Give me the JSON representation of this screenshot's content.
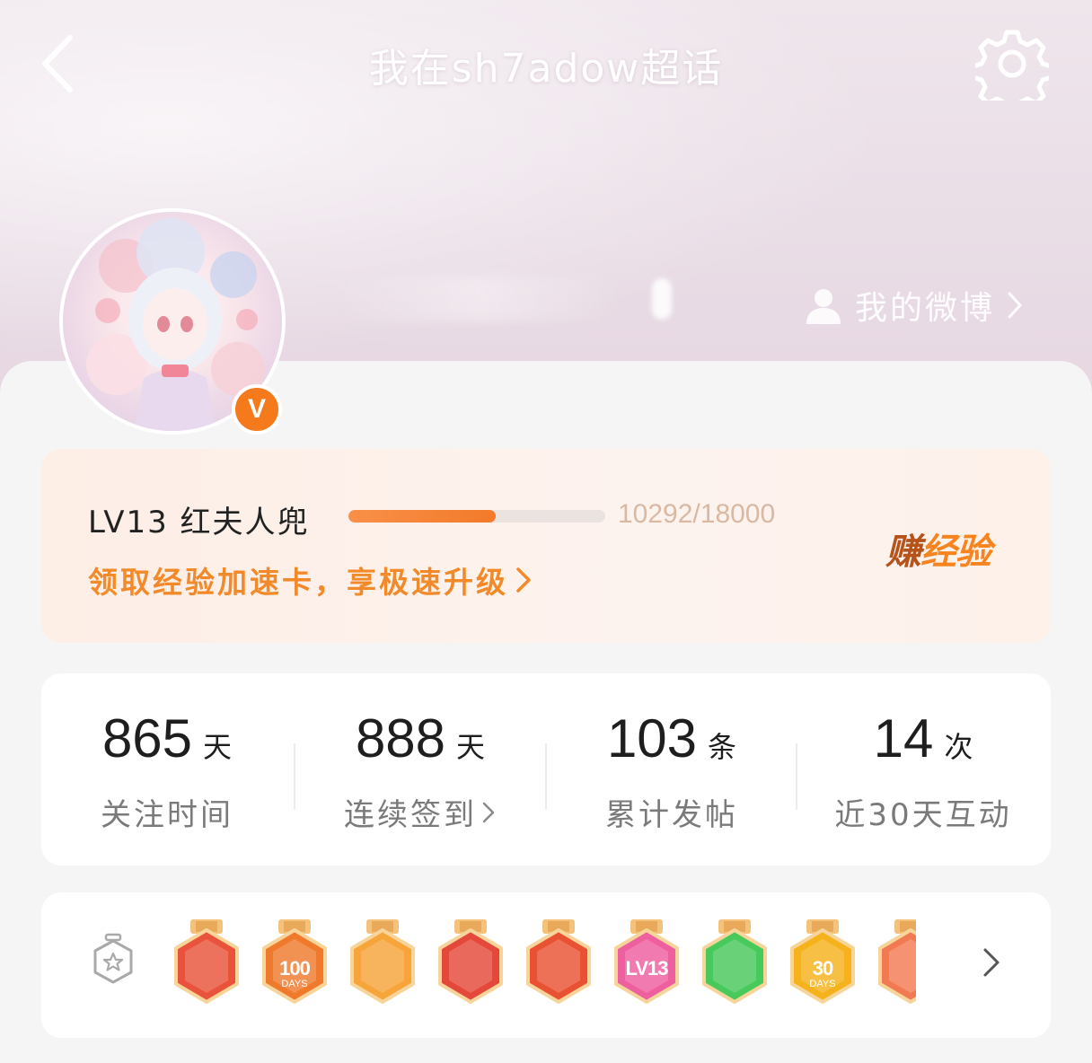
{
  "header": {
    "title": "我在sh7adow超话",
    "back_icon": "chevron-left-icon",
    "settings_icon": "gear-icon"
  },
  "profile": {
    "my_weibo_label": "我的微博",
    "verified_badge": "V"
  },
  "level": {
    "label": "LV13 红夫人兜",
    "progress_current": 10292,
    "progress_max": 18000,
    "progress_text": "10292/18000",
    "speed_link_label": "领取经验加速卡，享极速升级",
    "earn_part1": "赚",
    "earn_part2": "经验"
  },
  "stats": [
    {
      "value": "865",
      "unit": "天",
      "label": "关注时间",
      "has_arrow": false
    },
    {
      "value": "888",
      "unit": "天",
      "label": "连续签到",
      "has_arrow": true
    },
    {
      "value": "103",
      "unit": "条",
      "label": "累计发帖",
      "has_arrow": false
    },
    {
      "value": "14",
      "unit": "次",
      "label": "近30天互动",
      "has_arrow": false
    }
  ],
  "badges": {
    "items": [
      {
        "name": "dog-year-badge",
        "color": "#e9533b",
        "text": "",
        "sub": ""
      },
      {
        "name": "100-days-badge",
        "color": "#f07a2c",
        "text": "100",
        "sub": "DAYS"
      },
      {
        "name": "crown-badge",
        "color": "#f7a43a",
        "text": "",
        "sub": ""
      },
      {
        "name": "dog-red-badge",
        "color": "#e4483a",
        "text": "",
        "sub": ""
      },
      {
        "name": "dragon-badge",
        "color": "#e85232",
        "text": "",
        "sub": ""
      },
      {
        "name": "lv13-badge",
        "color": "#ee5fa0",
        "text": "LV13",
        "sub": ""
      },
      {
        "name": "hand-badge",
        "color": "#48c95b",
        "text": "",
        "sub": ""
      },
      {
        "name": "30-days-badge",
        "color": "#f6b21c",
        "text": "30",
        "sub": "DAYS"
      },
      {
        "name": "partial-badge",
        "color": "#f27a52",
        "text": "",
        "sub": ""
      }
    ]
  },
  "colors": {
    "accent_orange": "#f28a2a",
    "progress_fill": "#f27a2a",
    "vbadge": "#f47a1c"
  }
}
